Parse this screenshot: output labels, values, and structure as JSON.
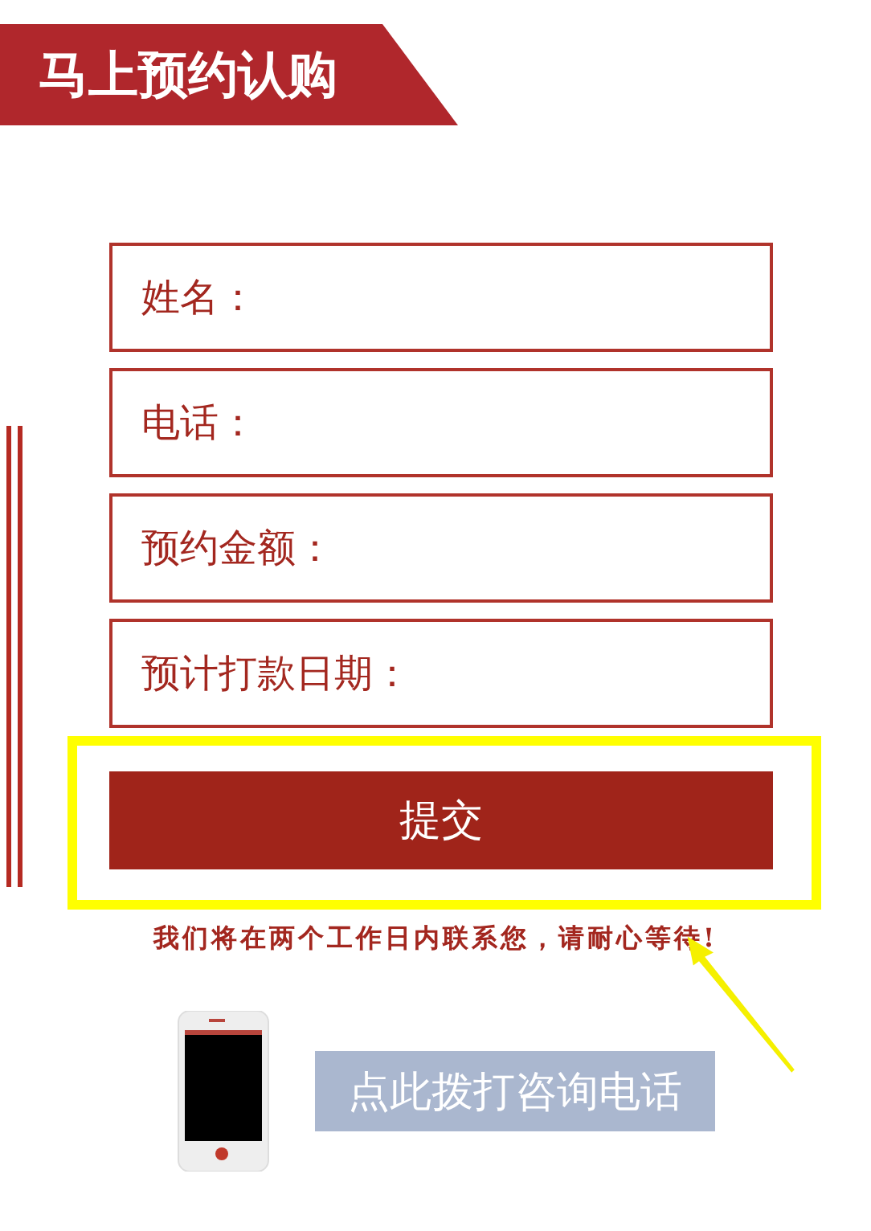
{
  "header": {
    "title": "马上预约认购"
  },
  "fields": [
    {
      "label": "姓名："
    },
    {
      "label": "电话："
    },
    {
      "label": "预约金额："
    },
    {
      "label": "预计打款日期："
    }
  ],
  "submit": {
    "label": "提交",
    "highlighted": true
  },
  "note": "我们将在两个工作日内联系您，请耐心等待!",
  "call_button": {
    "label": "点此拨打咨询电话"
  }
}
